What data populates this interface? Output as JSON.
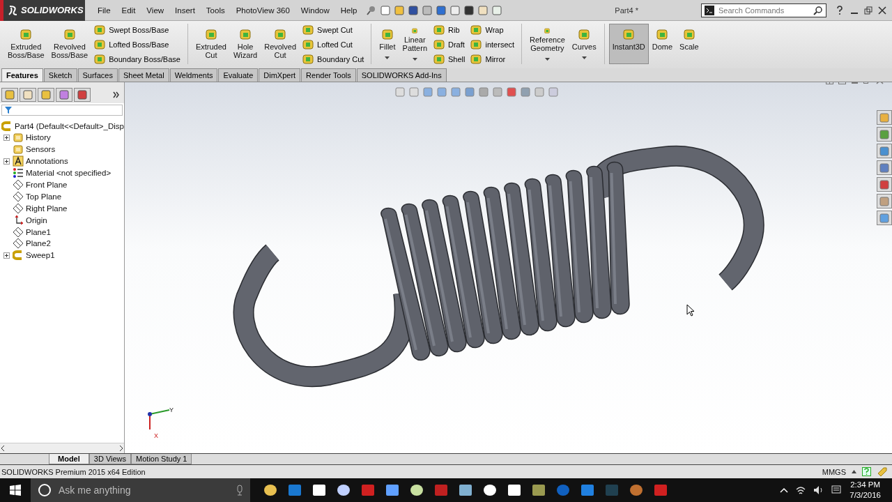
{
  "app_logo": "SOLIDWORKS",
  "menu": [
    "File",
    "Edit",
    "View",
    "Insert",
    "Tools",
    "PhotoView 360",
    "Window",
    "Help"
  ],
  "document_title": "Part4 *",
  "search": {
    "placeholder": "Search Commands"
  },
  "ribbon": [
    [
      {
        "kind": "large",
        "label": "Extruded\nBoss/Base",
        "dropdown": false,
        "pressed": false
      },
      {
        "kind": "large",
        "label": "Revolved\nBoss/Base",
        "dropdown": false,
        "pressed": false
      },
      {
        "kind": "stack",
        "items": [
          "Swept Boss/Base",
          "Lofted Boss/Base",
          "Boundary Boss/Base"
        ]
      }
    ],
    [
      {
        "kind": "large",
        "label": "Extruded\nCut",
        "dropdown": false,
        "pressed": false
      },
      {
        "kind": "large",
        "label": "Hole\nWizard",
        "dropdown": false,
        "pressed": false
      },
      {
        "kind": "large",
        "label": "Revolved\nCut",
        "dropdown": false,
        "pressed": false
      },
      {
        "kind": "stack",
        "items": [
          "Swept Cut",
          "Lofted Cut",
          "Boundary Cut"
        ]
      }
    ],
    [
      {
        "kind": "large",
        "label": "Fillet",
        "dropdown": true,
        "pressed": false
      },
      {
        "kind": "large",
        "label": "Linear\nPattern",
        "dropdown": true,
        "pressed": false
      },
      {
        "kind": "stack",
        "items": [
          "Rib",
          "Draft",
          "Shell"
        ]
      },
      {
        "kind": "stack",
        "items": [
          "Wrap",
          "intersect",
          "Mirror"
        ]
      }
    ],
    [
      {
        "kind": "large",
        "label": "Reference\nGeometry",
        "dropdown": true,
        "pressed": false
      },
      {
        "kind": "large",
        "label": "Curves",
        "dropdown": true,
        "pressed": false
      }
    ],
    [
      {
        "kind": "large",
        "label": "Instant3D",
        "dropdown": false,
        "pressed": true
      },
      {
        "kind": "large",
        "label": "Dome",
        "dropdown": false,
        "pressed": false
      },
      {
        "kind": "large",
        "label": "Scale",
        "dropdown": false,
        "pressed": false
      }
    ]
  ],
  "tabs": [
    {
      "label": "Features",
      "selected": true
    },
    {
      "label": "Sketch",
      "selected": false
    },
    {
      "label": "Surfaces",
      "selected": false
    },
    {
      "label": "Sheet Metal",
      "selected": false
    },
    {
      "label": "Weldments",
      "selected": false
    },
    {
      "label": "Evaluate",
      "selected": false
    },
    {
      "label": "DimXpert",
      "selected": false
    },
    {
      "label": "Render Tools",
      "selected": false
    },
    {
      "label": "SOLIDWORKS Add-Ins",
      "selected": false
    }
  ],
  "tree": {
    "root": "Part4  (Default<<Default>_Disp",
    "items": [
      {
        "label": "History",
        "kind": "history",
        "expanded": false
      },
      {
        "label": "Sensors",
        "kind": "sensor"
      },
      {
        "label": "Annotations",
        "kind": "annotation",
        "expanded": false
      },
      {
        "label": "Material <not specified>",
        "kind": "material"
      },
      {
        "label": "Front Plane",
        "kind": "plane"
      },
      {
        "label": "Top Plane",
        "kind": "plane"
      },
      {
        "label": "Right Plane",
        "kind": "plane"
      },
      {
        "label": "Origin",
        "kind": "origin"
      },
      {
        "label": "Plane1",
        "kind": "plane"
      },
      {
        "label": "Plane2",
        "kind": "plane"
      },
      {
        "label": "Sweep1",
        "kind": "sweep",
        "expanded": false
      }
    ]
  },
  "triad_labels": [
    "Y",
    "X"
  ],
  "bottom_tabs": [
    {
      "label": "Model",
      "selected": true
    },
    {
      "label": "3D Views",
      "selected": false
    },
    {
      "label": "Motion Study 1",
      "selected": false
    }
  ],
  "status": {
    "text": "SOLIDWORKS Premium 2015 x64 Edition",
    "units": "MMGS"
  },
  "taskbar": {
    "search": {
      "placeholder": "Ask me anything"
    },
    "time": "2:34 PM",
    "date": "7/3/2016"
  }
}
